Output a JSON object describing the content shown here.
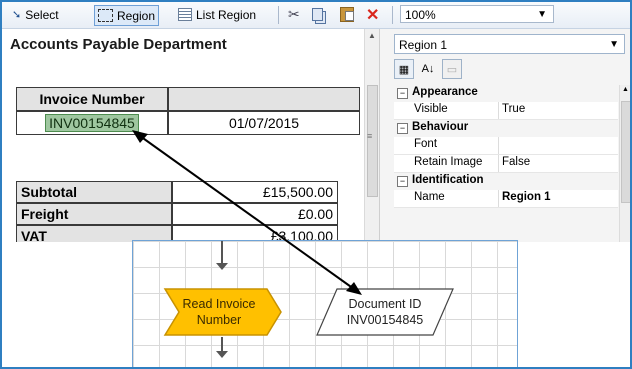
{
  "toolbar": {
    "select_label": "Select",
    "region_label": "Region",
    "list_region_label": "List Region",
    "zoom_value": "100%"
  },
  "document": {
    "title": "Accounts Payable Department",
    "invoice_header": "Invoice Number",
    "invoice_value": "INV00154845",
    "date_value": "01/07/2015",
    "rows": [
      {
        "label": "Subtotal",
        "amount": "£15,500.00"
      },
      {
        "label": "Freight",
        "amount": "£0.00"
      },
      {
        "label": "VAT",
        "amount": "£3,100.00"
      }
    ]
  },
  "properties": {
    "selected_object": "Region 1",
    "categories": [
      {
        "name": "Appearance",
        "items": [
          {
            "key": "Visible",
            "value": "True"
          }
        ]
      },
      {
        "name": "Behaviour",
        "items": [
          {
            "key": "Font",
            "value": ""
          },
          {
            "key": "Retain Image",
            "value": "False"
          }
        ]
      },
      {
        "name": "Identification",
        "items": [
          {
            "key": "Name",
            "value": "Region 1"
          }
        ]
      }
    ]
  },
  "flowchart": {
    "read_stage": {
      "line1": "Read Invoice",
      "line2": "Number"
    },
    "data_item": {
      "line1": "Document ID",
      "line2": "INV00154845"
    }
  },
  "colors": {
    "frame_border": "#2f7fc1",
    "read_stage_fill": "#ffc000",
    "highlight_fill": "#9fc7a0",
    "close_icon": "#d9261c"
  }
}
